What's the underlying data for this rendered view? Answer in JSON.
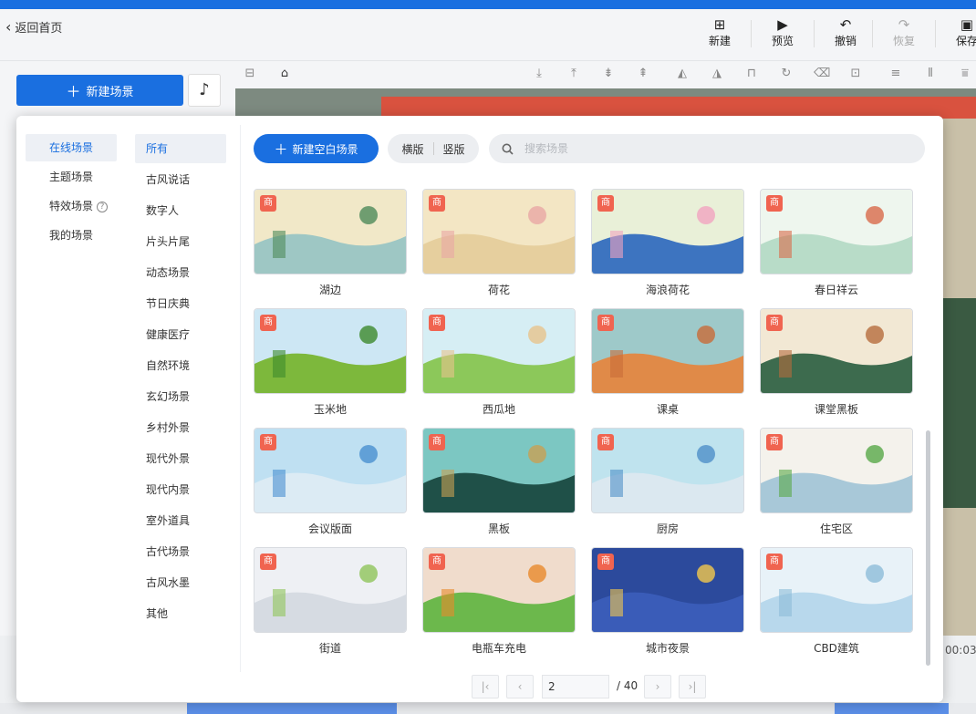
{
  "header": {
    "back_label": "返回首页",
    "buttons": [
      {
        "label": "新建",
        "icon": "plus-square-icon",
        "glyph": "⊞",
        "disabled": false
      },
      {
        "label": "预览",
        "icon": "play-icon",
        "glyph": "▶",
        "disabled": false
      },
      {
        "label": "撤销",
        "icon": "undo-icon",
        "glyph": "↶",
        "disabled": false
      },
      {
        "label": "恢复",
        "icon": "redo-icon",
        "glyph": "↷",
        "disabled": true
      },
      {
        "label": "保存",
        "icon": "save-icon",
        "glyph": "▣",
        "disabled": false
      }
    ]
  },
  "sidebar": {
    "new_scene_label": "新建场景",
    "music_icon": "music-note-icon"
  },
  "modal": {
    "primary_categories": [
      {
        "label": "在线场景",
        "active": true
      },
      {
        "label": "主题场景",
        "active": false
      },
      {
        "label": "特效场景",
        "active": false,
        "help": true
      },
      {
        "label": "我的场景",
        "active": false
      }
    ],
    "sub_categories": [
      {
        "label": "所有",
        "active": true
      },
      {
        "label": "古风说话"
      },
      {
        "label": "数字人"
      },
      {
        "label": "片头片尾"
      },
      {
        "label": "动态场景"
      },
      {
        "label": "节日庆典"
      },
      {
        "label": "健康医疗"
      },
      {
        "label": "自然环境"
      },
      {
        "label": "玄幻场景"
      },
      {
        "label": "乡村外景"
      },
      {
        "label": "现代外景"
      },
      {
        "label": "现代内景"
      },
      {
        "label": "室外道具"
      },
      {
        "label": "古代场景"
      },
      {
        "label": "古风水墨"
      },
      {
        "label": "其他"
      }
    ],
    "new_blank_label": "新建空白场景",
    "orientation": {
      "landscape": "横版",
      "portrait": "竖版"
    },
    "search_placeholder": "搜索场景",
    "badge_label": "商",
    "scenes": [
      {
        "name": "湖边",
        "sky": "#f1e8c8",
        "ground": "#9ec7c4",
        "accent": "#4f8a5a"
      },
      {
        "name": "荷花",
        "sky": "#f3e6c4",
        "ground": "#e6cf9e",
        "accent": "#e9a7a5"
      },
      {
        "name": "海浪荷花",
        "sky": "#e9f0d8",
        "ground": "#3d74c0",
        "accent": "#f1a4c0"
      },
      {
        "name": "春日祥云",
        "sky": "#eef6ee",
        "ground": "#b8dcc8",
        "accent": "#d86a4a"
      },
      {
        "name": "玉米地",
        "sky": "#cde7f4",
        "ground": "#7db83c",
        "accent": "#3d8a2c"
      },
      {
        "name": "西瓜地",
        "sky": "#d6eef4",
        "ground": "#8cc85a",
        "accent": "#e7c38c"
      },
      {
        "name": "课桌",
        "sky": "#9ec9c9",
        "ground": "#e08a48",
        "accent": "#c86c38"
      },
      {
        "name": "课堂黑板",
        "sky": "#f2e8d4",
        "ground": "#3d6b4e",
        "accent": "#b56b3c"
      },
      {
        "name": "会议版面",
        "sky": "#bfe0f2",
        "ground": "#dcebf4",
        "accent": "#4a90d0"
      },
      {
        "name": "黑板",
        "sky": "#7cc7c2",
        "ground": "#1f5048",
        "accent": "#c8a054"
      },
      {
        "name": "厨房",
        "sky": "#bfe3ee",
        "ground": "#dbe8f0",
        "accent": "#4f8fc8"
      },
      {
        "name": "住宅区",
        "sky": "#f4f2ec",
        "ground": "#a8c8d8",
        "accent": "#58a848"
      },
      {
        "name": "街道",
        "sky": "#eef0f4",
        "ground": "#d6dbe2",
        "accent": "#8fc45a"
      },
      {
        "name": "电瓶车充电",
        "sky": "#f0dccc",
        "ground": "#6cb84c",
        "accent": "#e88a2c"
      },
      {
        "name": "城市夜景",
        "sky": "#2c4a9c",
        "ground": "#3a5cb8",
        "accent": "#f4c84c"
      },
      {
        "name": "CBD建筑",
        "sky": "#e8f2f8",
        "ground": "#b8d8ec",
        "accent": "#8cbcd8"
      }
    ],
    "pagination": {
      "current": "2",
      "total": "/ 40"
    }
  },
  "timeline": {
    "time_text": "00:03"
  }
}
